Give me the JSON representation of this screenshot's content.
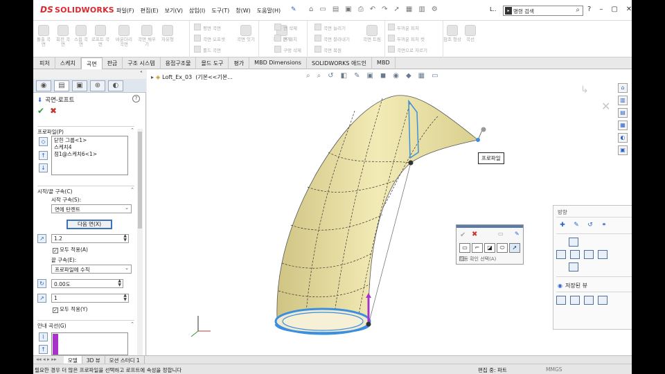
{
  "app": {
    "logo_prefix": "DS",
    "logo_name": "SOLIDWORKS"
  },
  "menu": [
    "파일(F)",
    "편집(E)",
    "보기(V)",
    "삽입(I)",
    "도구(T)",
    "창(W)",
    "도움말(H)"
  ],
  "titlebar": {
    "partial_label": "L..",
    "search_placeholder": "명령 검색"
  },
  "ribbon": {
    "large": [
      "돌출 곡면",
      "회전 곡면",
      "스윕 곡면",
      "로프트 곡면",
      "바운더리 곡면",
      "곡면 채우기",
      "자유형",
      "평면 곡면",
      "곡면 잇기",
      "곡면 전개"
    ],
    "small": [
      "평면 곡면",
      "곡면 오프셋",
      "룰드 곡면",
      "면 삭제",
      "면 대치",
      "구멍 삭제",
      "곡면 늘리기",
      "곡면 잘라내기",
      "곡면 복원",
      "두꺼운 피처",
      "두꺼운 피처 컷",
      "곡면으로 자르기"
    ],
    "extra": [
      "곡면 트림",
      "참조 형상",
      "곡선"
    ]
  },
  "tabs": [
    "피처",
    "스케치",
    "곡면",
    "판금",
    "구조 시스템",
    "용접구조물",
    "몰드 도구",
    "평가",
    "MBD Dimensions",
    "SOLIDWORKS 애드인",
    "MBD"
  ],
  "active_tab": "곡면",
  "property_manager": {
    "title": "곡면-로프트",
    "profiles_header": "프로파일(P)",
    "profiles": [
      "닫힌 그룹<1>",
      "스케치4",
      "점1@스케치6<1>"
    ],
    "start_end_header": "시작/끝 구속(C)",
    "start_label": "시작 구속(S):",
    "start_value": "면에 탄젠트",
    "next_face_button": "다음 면(X)",
    "start_value_num": "1.2",
    "apply_all_1": "모두 적용(A)",
    "end_label": "끝 구속(E):",
    "end_value": "프로파일에 수직",
    "angle_value": "0.00도",
    "end_value_num": "1",
    "apply_all_2": "모두 적용(Y)",
    "guide_header": "안내 곡선(G)"
  },
  "viewport": {
    "tree_label": "Loft_Ex_03",
    "config_label": "(기본<<기본...",
    "callout": "프로파일"
  },
  "selection_manager": {
    "auto_confirm": "자동 확인 선택(A)"
  },
  "orientation": {
    "title": "방향",
    "saved_views": "저장된 뷰"
  },
  "bottom_tabs": [
    "모델",
    "3D 뷰",
    "모션 스터디 1"
  ],
  "status": {
    "message": "필요한 경우 더 많은 프로파일을 선택하고 로프트에 속성을 정합니다",
    "editing": "편집 중: 파트",
    "units": "MMGS"
  },
  "colors": {
    "surface": "#efe6a8",
    "selection_blue": "#3a8fe0",
    "connector_purple": "#a733c9",
    "brand_red": "#d8292f"
  },
  "icons": [
    "home-icon",
    "open-icon",
    "save-icon",
    "print-icon",
    "undo-icon",
    "gear-icon",
    "pin-icon",
    "help-icon",
    "ok-icon",
    "cancel-icon"
  ]
}
